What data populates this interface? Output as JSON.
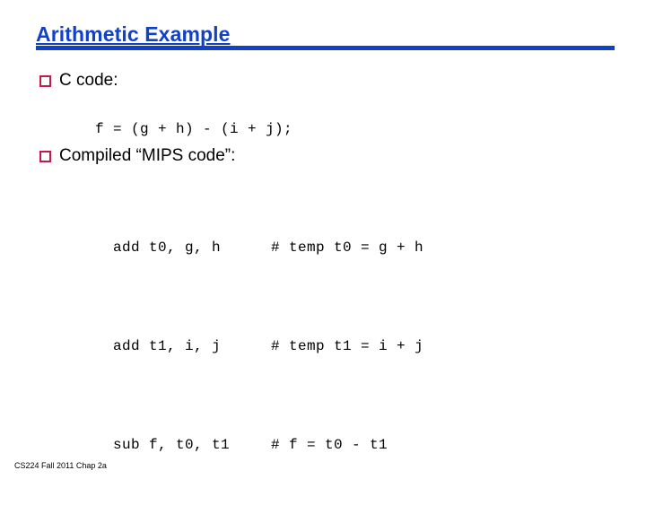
{
  "slide": {
    "title": "Arithmetic Example",
    "footer": "CS224 Fall 2011 Chap 2a",
    "background_color": "#ffffff",
    "accent_color": "#1141C8",
    "bullet_color": "#C21B4B",
    "text_color": "#000000"
  },
  "bullets": [
    {
      "label": "C code:"
    },
    {
      "label": "Compiled “MIPS code”:"
    }
  ],
  "c_code": {
    "line": "f = (g + h) - (i + j);"
  },
  "mips_code": {
    "lines": [
      {
        "instruction": "add t0, g, h",
        "comment": "# temp t0 = g + h"
      },
      {
        "instruction": "add t1, i, j",
        "comment": "# temp t1 = i + j"
      },
      {
        "instruction": "sub f, t0, t1",
        "comment": "# f = t0 - t1"
      }
    ]
  }
}
